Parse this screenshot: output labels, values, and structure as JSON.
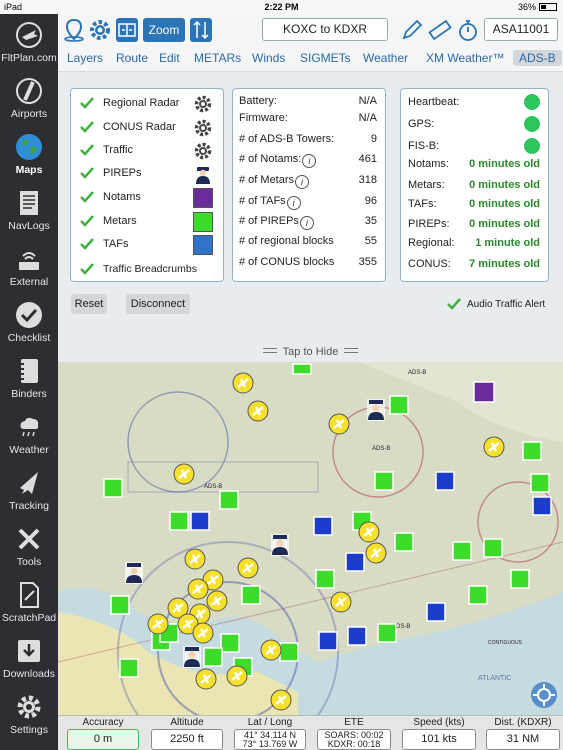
{
  "status_bar": {
    "device": "iPad",
    "time": "2:22 PM",
    "battery": "36%"
  },
  "sidebar": {
    "items": [
      {
        "label": "FltPlan.com",
        "icon": "plane-globe-icon"
      },
      {
        "label": "Airports",
        "icon": "runway-icon"
      },
      {
        "label": "Maps",
        "icon": "globe-icon",
        "active": true
      },
      {
        "label": "NavLogs",
        "icon": "navlog-icon"
      },
      {
        "label": "External",
        "icon": "wifi-router-icon"
      },
      {
        "label": "Checklist",
        "icon": "checkmark-icon"
      },
      {
        "label": "Binders",
        "icon": "binder-icon"
      },
      {
        "label": "Weather",
        "icon": "cloud-rain-icon"
      },
      {
        "label": "Tracking",
        "icon": "tracking-plane-icon"
      },
      {
        "label": "Tools",
        "icon": "tools-icon"
      },
      {
        "label": "ScratchPad",
        "icon": "scratchpad-icon"
      },
      {
        "label": "Downloads",
        "icon": "download-icon"
      },
      {
        "label": "Settings",
        "icon": "gear-icon"
      }
    ]
  },
  "toolbar": {
    "zoom_label": "Zoom",
    "route": "KOXC to KDXR",
    "aircraft": "ASA11001"
  },
  "tabs": [
    "Layers",
    "Route",
    "Edit",
    "METARs",
    "Winds",
    "SIGMETs",
    "Weather",
    "XM Weather™",
    "ADS-B"
  ],
  "active_tab": "ADS-B",
  "layers": [
    {
      "label": "Regional Radar",
      "control": "gear"
    },
    {
      "label": "CONUS Radar",
      "control": "gear"
    },
    {
      "label": "Traffic",
      "control": "gear"
    },
    {
      "label": "PIREPs",
      "control": "pilot"
    },
    {
      "label": "Notams",
      "control": "swatch",
      "color": "#6a2c9a"
    },
    {
      "label": "Metars",
      "control": "swatch",
      "color": "#3ddc2a"
    },
    {
      "label": "TAFs",
      "control": "swatch",
      "color": "#2f73c8"
    },
    {
      "label": "Traffic Breadcrumbs",
      "control": "none"
    }
  ],
  "device_info": [
    {
      "label": "Battery:",
      "value": "N/A"
    },
    {
      "label": "Firmware:",
      "value": "N/A"
    },
    {
      "label": "# of ADS-B Towers:",
      "value": "9"
    },
    {
      "label": "# of Notams:",
      "value": "461",
      "info": true
    },
    {
      "label": "# of Metars",
      "value": "318",
      "info": true
    },
    {
      "label": "# of TAFs",
      "value": "96",
      "info": true
    },
    {
      "label": "# of PIREPs",
      "value": "35",
      "info": true
    },
    {
      "label": "# of regional blocks",
      "value": "55"
    },
    {
      "label": "# of CONUS blocks",
      "value": "355"
    }
  ],
  "status": {
    "indicators": [
      {
        "label": "Heartbeat:",
        "state": "ok"
      },
      {
        "label": "GPS:",
        "state": "ok"
      },
      {
        "label": "FIS-B:",
        "state": "ok"
      }
    ],
    "ages": [
      {
        "label": "Notams:",
        "value": "0 minutes old"
      },
      {
        "label": "Metars:",
        "value": "0 minutes old"
      },
      {
        "label": "TAFs:",
        "value": "0 minutes old"
      },
      {
        "label": "PIREPs:",
        "value": "0 minutes old"
      },
      {
        "label": "Regional:",
        "value": "1 minute old"
      },
      {
        "label": "CONUS:",
        "value": "7 minutes old"
      }
    ]
  },
  "buttons": {
    "reset": "Reset",
    "disconnect": "Disconnect"
  },
  "audio_alert": "Audio Traffic Alert",
  "tap_to_hide": "Tap to Hide",
  "map": {
    "ads_b_label": "ADS-B",
    "atlantic": "ATLANTIC",
    "contiguous": "CONTIGUOUS"
  },
  "bottom": {
    "accuracy": {
      "label": "Accuracy",
      "value": "0 m"
    },
    "altitude": {
      "label": "Altitude",
      "value": "2250 ft"
    },
    "latlong": {
      "label": "Lat / Long",
      "lat": "41° 34.114 N",
      "lon": "73° 13.769 W"
    },
    "ete": {
      "label": "ETE",
      "line1": "SOARS: 00:02",
      "line2": "KDXR: 00:18"
    },
    "speed": {
      "label": "Speed (kts)",
      "value": "101 kts"
    },
    "dist": {
      "label": "Dist. (KDXR)",
      "value": "31 NM"
    }
  }
}
